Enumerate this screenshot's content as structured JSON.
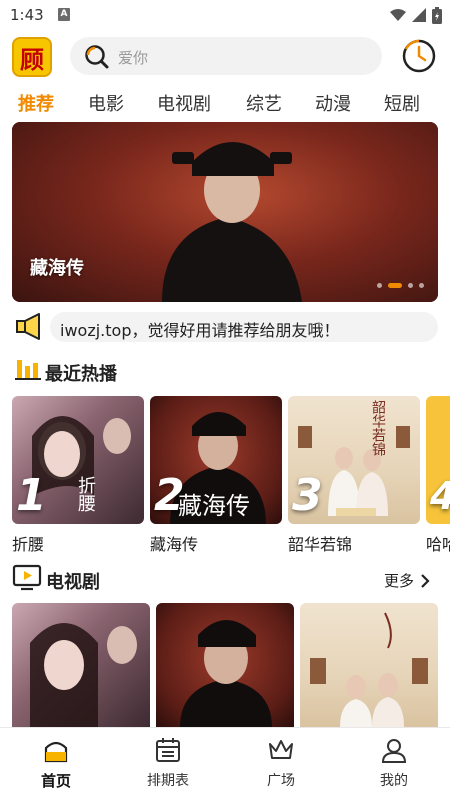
{
  "status_bar": {
    "time": "1:43",
    "a_badge": "A"
  },
  "header": {
    "logo_text": "顾",
    "search_placeholder": "爱你"
  },
  "tabs": [
    {
      "label": "推荐",
      "active": true
    },
    {
      "label": "电影"
    },
    {
      "label": "电视剧"
    },
    {
      "label": "综艺"
    },
    {
      "label": "动漫"
    },
    {
      "label": "短剧"
    }
  ],
  "banner": {
    "title": "藏海传",
    "dots": 4,
    "active_dot": 2
  },
  "notice": {
    "text": "iwozj.top，觉得好用请推荐给朋友哦！"
  },
  "recent": {
    "title": "最近热播",
    "items": [
      {
        "rank": "1",
        "name": "折腰",
        "poster_text": "折腰"
      },
      {
        "rank": "2",
        "name": "藏海传",
        "poster_text": "藏海传"
      },
      {
        "rank": "3",
        "name": "韶华若锦",
        "poster_text": "韶华若锦"
      },
      {
        "rank": "4",
        "name": "哈哈"
      }
    ]
  },
  "tv": {
    "title": "电视剧",
    "more_label": "更多"
  },
  "bottom_nav": [
    {
      "label": "首页",
      "icon": "home-icon",
      "active": true
    },
    {
      "label": "排期表",
      "icon": "calendar-icon"
    },
    {
      "label": "广场",
      "icon": "crown-icon"
    },
    {
      "label": "我的",
      "icon": "user-icon"
    }
  ],
  "colors": {
    "accent": "#f08a00",
    "logo_bg": "#f7c600"
  }
}
